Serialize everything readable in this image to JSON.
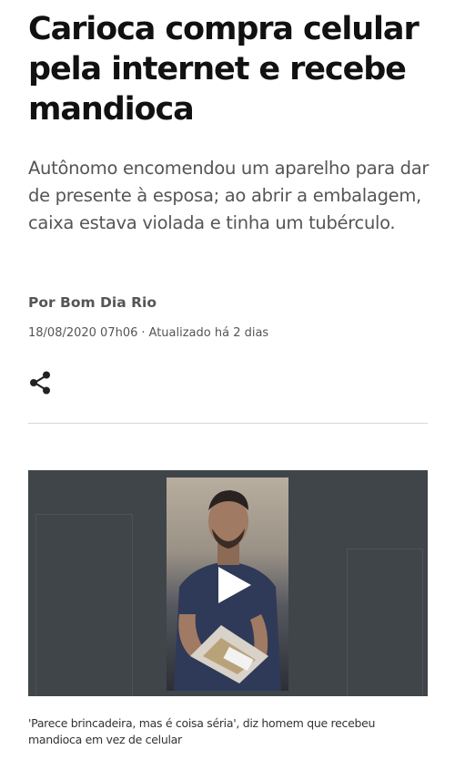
{
  "article": {
    "headline": "Carioca compra celular pela internet e recebe mandioca",
    "subtitle": "Autônomo encomendou um aparelho para dar de presente à esposa; ao abrir a embalagem, caixa estava violada e tinha um tubérculo.",
    "byline": "Por Bom Dia Rio",
    "published": "18/08/2020 07h06",
    "separator": "·",
    "updated": "Atualizado há 2 dias"
  },
  "share": {
    "icon": "share-icon"
  },
  "video": {
    "play_icon": "play-icon",
    "caption": "'Parece brincadeira, mas é coisa séria', diz homem que recebeu mandioca em vez de celular"
  },
  "colors": {
    "text_primary": "#111111",
    "text_secondary": "#555555",
    "divider": "#d8d8d8",
    "video_background": "#3f4549"
  }
}
